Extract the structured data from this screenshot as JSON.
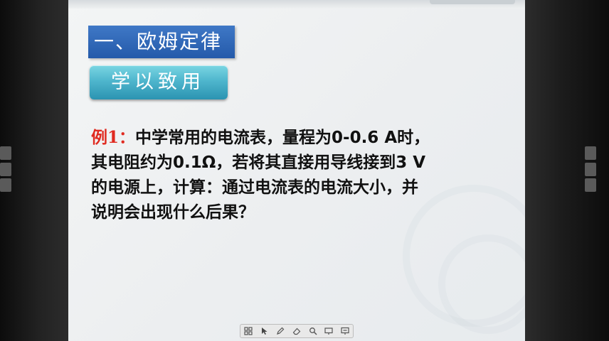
{
  "slide": {
    "section_title": "一、欧姆定律",
    "apply_button": "学以致用",
    "example": {
      "label": "例1：",
      "lines": [
        "中学常用的电流表，量程为0-0.6 A时，",
        "其电阻约为0.1Ω，若将其直接用导线接到3 V",
        "的电源上，计算：通过电流表的电流大小，并",
        "说明会出现什么后果？"
      ]
    }
  },
  "toolbar": {
    "tools": [
      {
        "icon": "grid-icon"
      },
      {
        "icon": "pointer-icon"
      },
      {
        "icon": "pen-icon"
      },
      {
        "icon": "eraser-icon"
      },
      {
        "icon": "magnifier-icon"
      },
      {
        "icon": "screen-icon"
      },
      {
        "icon": "exit-presentation-icon"
      }
    ]
  },
  "colors": {
    "title_bg": "#2f66b5",
    "button_bg": "#4fb6cd",
    "example_label": "#e02a20",
    "text": "#111111"
  }
}
